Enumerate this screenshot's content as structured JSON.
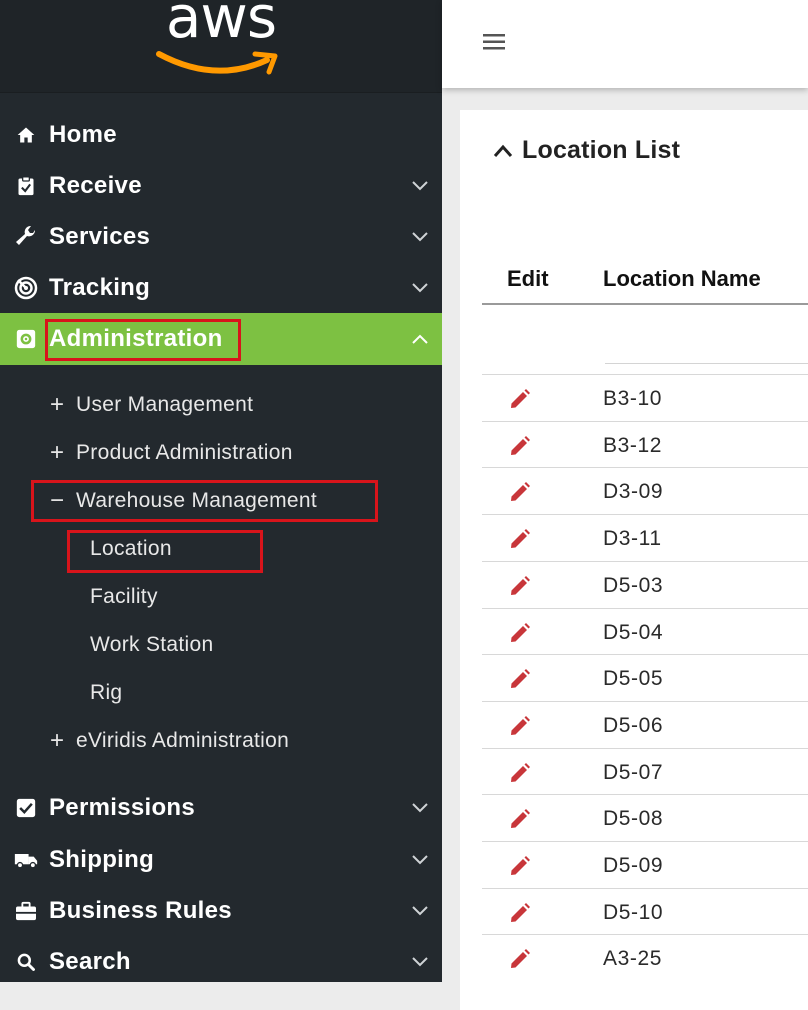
{
  "logo": {
    "text": "aws",
    "smile_color": "#ff9900"
  },
  "sidebar": {
    "items": [
      {
        "label": "Home",
        "icon": "home-icon"
      },
      {
        "label": "Receive",
        "icon": "clipboard-check-icon"
      },
      {
        "label": "Services",
        "icon": "wrench-icon"
      },
      {
        "label": "Tracking",
        "icon": "radar-icon"
      },
      {
        "label": "Administration",
        "icon": "admin-gear-icon",
        "active": true
      },
      {
        "label": "Permissions",
        "icon": "checkbox-icon"
      },
      {
        "label": "Shipping",
        "icon": "truck-icon"
      },
      {
        "label": "Business Rules",
        "icon": "briefcase-icon"
      },
      {
        "label": "Search",
        "icon": "search-icon"
      }
    ],
    "admin_sub": [
      {
        "sign": "+",
        "label": "User Management"
      },
      {
        "sign": "+",
        "label": "Product Administration"
      },
      {
        "sign": "−",
        "label": "Warehouse Management"
      },
      {
        "sign": "+",
        "label": "eViridis Administration"
      }
    ],
    "warehouse_sub": [
      "Location",
      "Facility",
      "Work Station",
      "Rig"
    ],
    "active_color": "#7dc142",
    "highlight_color": "#d8141b"
  },
  "main": {
    "title": "Location List",
    "columns": {
      "edit": "Edit",
      "name": "Location Name"
    },
    "rows": [
      "B3-10",
      "B3-12",
      "D3-09",
      "D3-11",
      "D5-03",
      "D5-04",
      "D5-05",
      "D5-06",
      "D5-07",
      "D5-08",
      "D5-09",
      "D5-10",
      "A3-25"
    ],
    "edit_color": "#c8363a"
  }
}
